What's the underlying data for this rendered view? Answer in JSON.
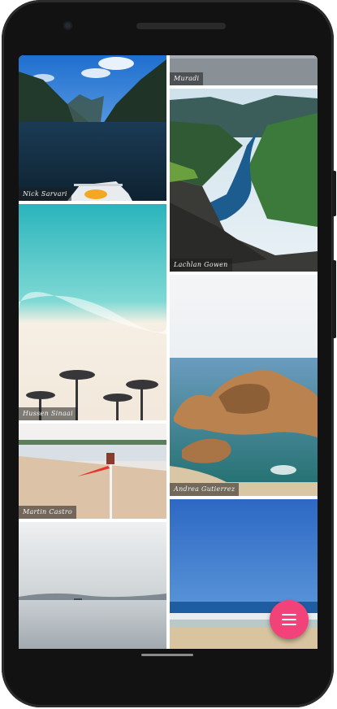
{
  "photos": [
    {
      "credit": "Nick Sarvari"
    },
    {
      "credit": "Hussen Sinaai"
    },
    {
      "credit": "Martin Castro"
    },
    {
      "credit": "Muradi"
    },
    {
      "credit": "Lachlan Gowen"
    },
    {
      "credit": "Andrea Gutierrez"
    }
  ],
  "fab": {
    "icon": "menu-icon",
    "color": "#f2427a"
  }
}
